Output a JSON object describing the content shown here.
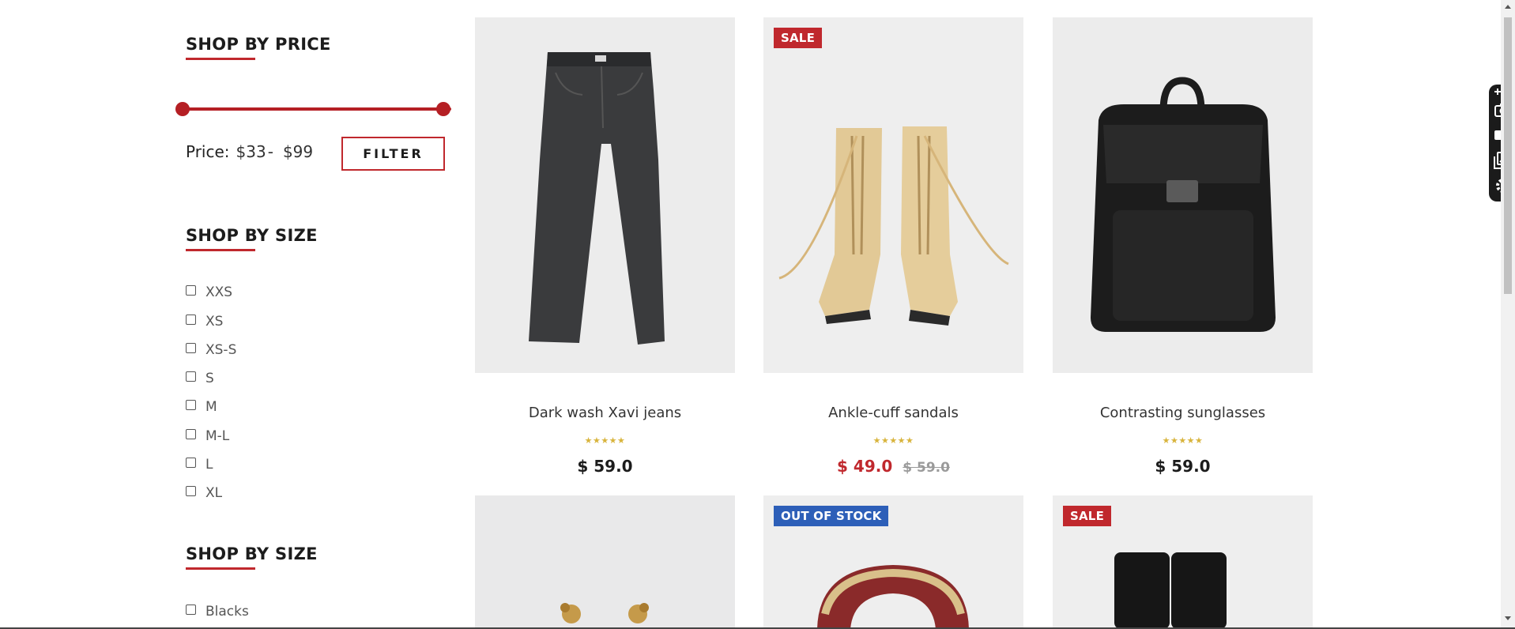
{
  "sidebar": {
    "price_section": {
      "title": "SHOP BY PRICE",
      "label": "Price:",
      "min": "$33",
      "separator": "-",
      "max": "$99",
      "filter_label": "FILTER"
    },
    "size_section": {
      "title": "SHOP BY SIZE",
      "options": [
        "XXS",
        "XS",
        "XS-S",
        "S",
        "M",
        "M-L",
        "L",
        "XL"
      ]
    },
    "color_section": {
      "title": "SHOP BY SIZE",
      "options": [
        "Blacks"
      ]
    }
  },
  "products": [
    {
      "name": "Dark wash Xavi jeans",
      "badge": "",
      "stars": "★★★★★",
      "price": "$ 59.0",
      "old_price": ""
    },
    {
      "name": "Ankle-cuff sandals",
      "badge": "SALE",
      "stars": "★★★★★",
      "price": "$ 49.0",
      "old_price": "$ 59.0"
    },
    {
      "name": "Contrasting sunglasses",
      "badge": "",
      "stars": "★★★★★",
      "price": "$ 59.0",
      "old_price": ""
    },
    {
      "name": "",
      "badge": "",
      "stars": "",
      "price": "",
      "old_price": ""
    },
    {
      "name": "",
      "badge": "OUT OF STOCK",
      "stars": "",
      "price": "",
      "old_price": ""
    },
    {
      "name": "",
      "badge": "SALE",
      "stars": "",
      "price": "",
      "old_price": ""
    }
  ],
  "colors": {
    "accent": "#c0282d",
    "star": "#d8b43c",
    "out_of_stock": "#2d5fb8"
  },
  "toolbar": {
    "icons": [
      "expand-icon",
      "camera-icon",
      "video-icon",
      "gallery-icon",
      "gear-icon"
    ]
  }
}
